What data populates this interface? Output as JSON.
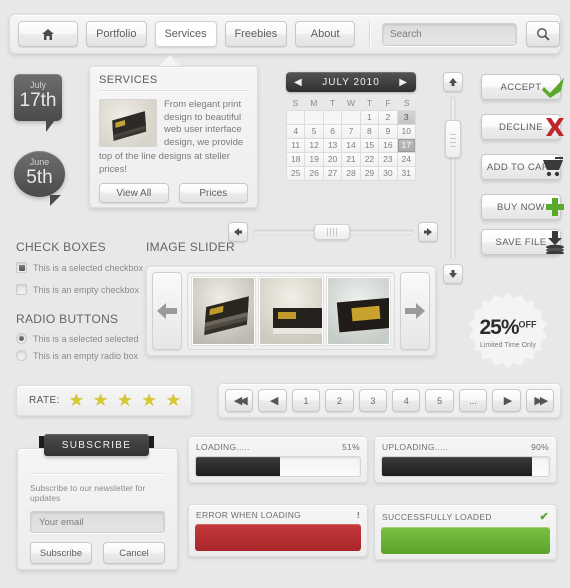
{
  "navbar": {
    "home_icon": "home-icon",
    "items": [
      {
        "label": "Portfolio",
        "active": false
      },
      {
        "label": "Services",
        "active": true
      },
      {
        "label": "Freebies",
        "active": false
      },
      {
        "label": "About",
        "active": false
      }
    ],
    "search_placeholder": "Search",
    "search_icon": "magnifier-icon"
  },
  "services": {
    "title": "SERVICES",
    "text": "From elegant print design to beautiful web user interface design, we provide",
    "text2": "top of the line designs at steller prices!",
    "buttons": [
      {
        "label": "View All"
      },
      {
        "label": "Prices"
      }
    ]
  },
  "bubbles": [
    {
      "month": "July",
      "day": "17th"
    },
    {
      "month": "June",
      "day": "5th"
    }
  ],
  "calendar": {
    "title": "JULY 2010",
    "prev_icon": "arrow-left-icon",
    "next_icon": "arrow-right-icon",
    "dows": [
      "S",
      "M",
      "T",
      "W",
      "T",
      "F",
      "S"
    ],
    "leading_blanks": 4,
    "days": [
      1,
      2,
      3,
      4,
      5,
      6,
      7,
      8,
      9,
      10,
      11,
      12,
      13,
      14,
      15,
      16,
      17,
      18,
      19,
      20,
      21,
      22,
      23,
      24,
      25,
      26,
      27,
      28,
      29,
      30,
      31
    ],
    "highlighted": 3,
    "selected": 17
  },
  "vslider": {
    "up_icon": "arrow-up-icon",
    "down_icon": "arrow-down-icon"
  },
  "actions": [
    {
      "label": "ACCEPT",
      "glyph": "✔",
      "color": "#5aa82c",
      "icon": "check-icon"
    },
    {
      "label": "DECLINE",
      "glyph": "✘",
      "color": "#c0272d",
      "icon": "cross-icon"
    },
    {
      "label": "ADD TO CART",
      "glyph": "🛒",
      "color": "#3a3a3a",
      "icon": "cart-icon"
    },
    {
      "label": "BUY NOW",
      "glyph": "✚",
      "color": "#5aa82c",
      "icon": "plus-icon"
    },
    {
      "label": "SAVE FILE",
      "glyph": "⬇",
      "color": "#3a3a3a",
      "icon": "download-icon"
    }
  ],
  "checkboxes": {
    "title": "CHECK BOXES",
    "items": [
      {
        "label": "This is a selected checkbox",
        "checked": true
      },
      {
        "label": "This is an empty checkbox",
        "checked": false
      }
    ]
  },
  "radios": {
    "title": "RADIO BUTTONS",
    "items": [
      {
        "label": "This is a selected selected",
        "checked": true
      },
      {
        "label": "This is an empty radio box",
        "checked": false
      }
    ]
  },
  "hslider": {
    "left_icon": "arrow-left-icon",
    "right_icon": "arrow-right-icon"
  },
  "imageslider": {
    "title": "IMAGE SLIDER",
    "prev_icon": "arrow-left-icon",
    "next_icon": "arrow-right-icon",
    "slides": [
      "business-card-fan",
      "business-card-stack",
      "business-card-tweed"
    ]
  },
  "discount": {
    "percent": "25%",
    "off": "OFF",
    "sub": "Limited Time Only"
  },
  "rate": {
    "label": "RATE:",
    "stars": 5,
    "star_glyph": "★"
  },
  "pagination": {
    "items": [
      {
        "label": "◀◀",
        "type": "first",
        "icon": "double-arrow-left-icon"
      },
      {
        "label": "◀",
        "type": "prev",
        "icon": "arrow-left-icon"
      },
      {
        "label": "1",
        "type": "page"
      },
      {
        "label": "2",
        "type": "page"
      },
      {
        "label": "3",
        "type": "page"
      },
      {
        "label": "4",
        "type": "page"
      },
      {
        "label": "5",
        "type": "page"
      },
      {
        "label": "...",
        "type": "ellipsis"
      },
      {
        "label": "▶",
        "type": "next",
        "icon": "arrow-right-icon"
      },
      {
        "label": "▶▶",
        "type": "last",
        "icon": "double-arrow-right-icon"
      }
    ]
  },
  "subscribe": {
    "ribbon": "SUBSCRIBE",
    "desc": "Subscribe to our newsletter for updates",
    "email_placeholder": "Your email",
    "submit_label": "Subscribe",
    "cancel_label": "Cancel"
  },
  "progress": [
    {
      "label": "LOADING.....",
      "value": "51%",
      "percent": 51
    },
    {
      "label": "UPLOADING.....",
      "value": "90%",
      "percent": 90
    }
  ],
  "status": [
    {
      "label": "ERROR WHEN LOADING",
      "glyph": "!",
      "kind": "err",
      "icon": "exclamation-icon"
    },
    {
      "label": "SUCCESSFULLY LOADED",
      "glyph": "✔",
      "kind": "ok",
      "icon": "check-icon"
    }
  ],
  "colors": {
    "background": "#e8e8e8",
    "error": "#b42d31",
    "success": "#69b234",
    "star": "#d8c832"
  }
}
